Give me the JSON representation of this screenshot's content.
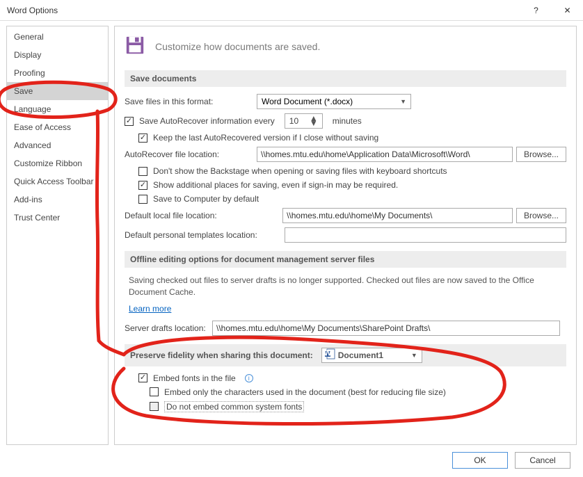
{
  "titlebar": {
    "title": "Word Options",
    "help": "?",
    "close": "✕"
  },
  "sidebar": {
    "items": [
      "General",
      "Display",
      "Proofing",
      "Save",
      "Language",
      "Ease of Access",
      "Advanced",
      "Customize Ribbon",
      "Quick Access Toolbar",
      "Add-ins",
      "Trust Center"
    ],
    "selected_index": 3
  },
  "header": {
    "text": "Customize how documents are saved."
  },
  "sections": {
    "save_docs": {
      "title": "Save documents",
      "format_label": "Save files in this format:",
      "format_value": "Word Document (*.docx)",
      "autorecover_label_a": "Save AutoRecover information every",
      "autorecover_value": "10",
      "autorecover_label_b": "minutes",
      "keep_last": "Keep the last AutoRecovered version if I close without saving",
      "autorecover_loc_label": "AutoRecover file location:",
      "autorecover_loc_value": "\\\\homes.mtu.edu\\home\\Application Data\\Microsoft\\Word\\",
      "browse": "Browse...",
      "dont_show_backstage": "Don't show the Backstage when opening or saving files with keyboard shortcuts",
      "show_additional": "Show additional places for saving, even if sign-in may be required.",
      "save_to_computer": "Save to Computer by default",
      "default_local_label": "Default local file location:",
      "default_local_value": "\\\\homes.mtu.edu\\home\\My Documents\\",
      "default_templates_label": "Default personal templates location:",
      "default_templates_value": ""
    },
    "offline": {
      "title": "Offline editing options for document management server files",
      "para": "Saving checked out files to server drafts is no longer supported. Checked out files are now saved to the Office Document Cache.",
      "link": "Learn more",
      "drafts_label": "Server drafts location:",
      "drafts_value": "\\\\homes.mtu.edu\\home\\My Documents\\SharePoint Drafts\\"
    },
    "fidelity": {
      "title": "Preserve fidelity when sharing this document:",
      "doc_name": "Document1",
      "embed_fonts": "Embed fonts in the file",
      "embed_chars": "Embed only the characters used in the document (best for reducing file size)",
      "no_common": "Do not embed common system fonts"
    }
  },
  "footer": {
    "ok": "OK",
    "cancel": "Cancel"
  }
}
